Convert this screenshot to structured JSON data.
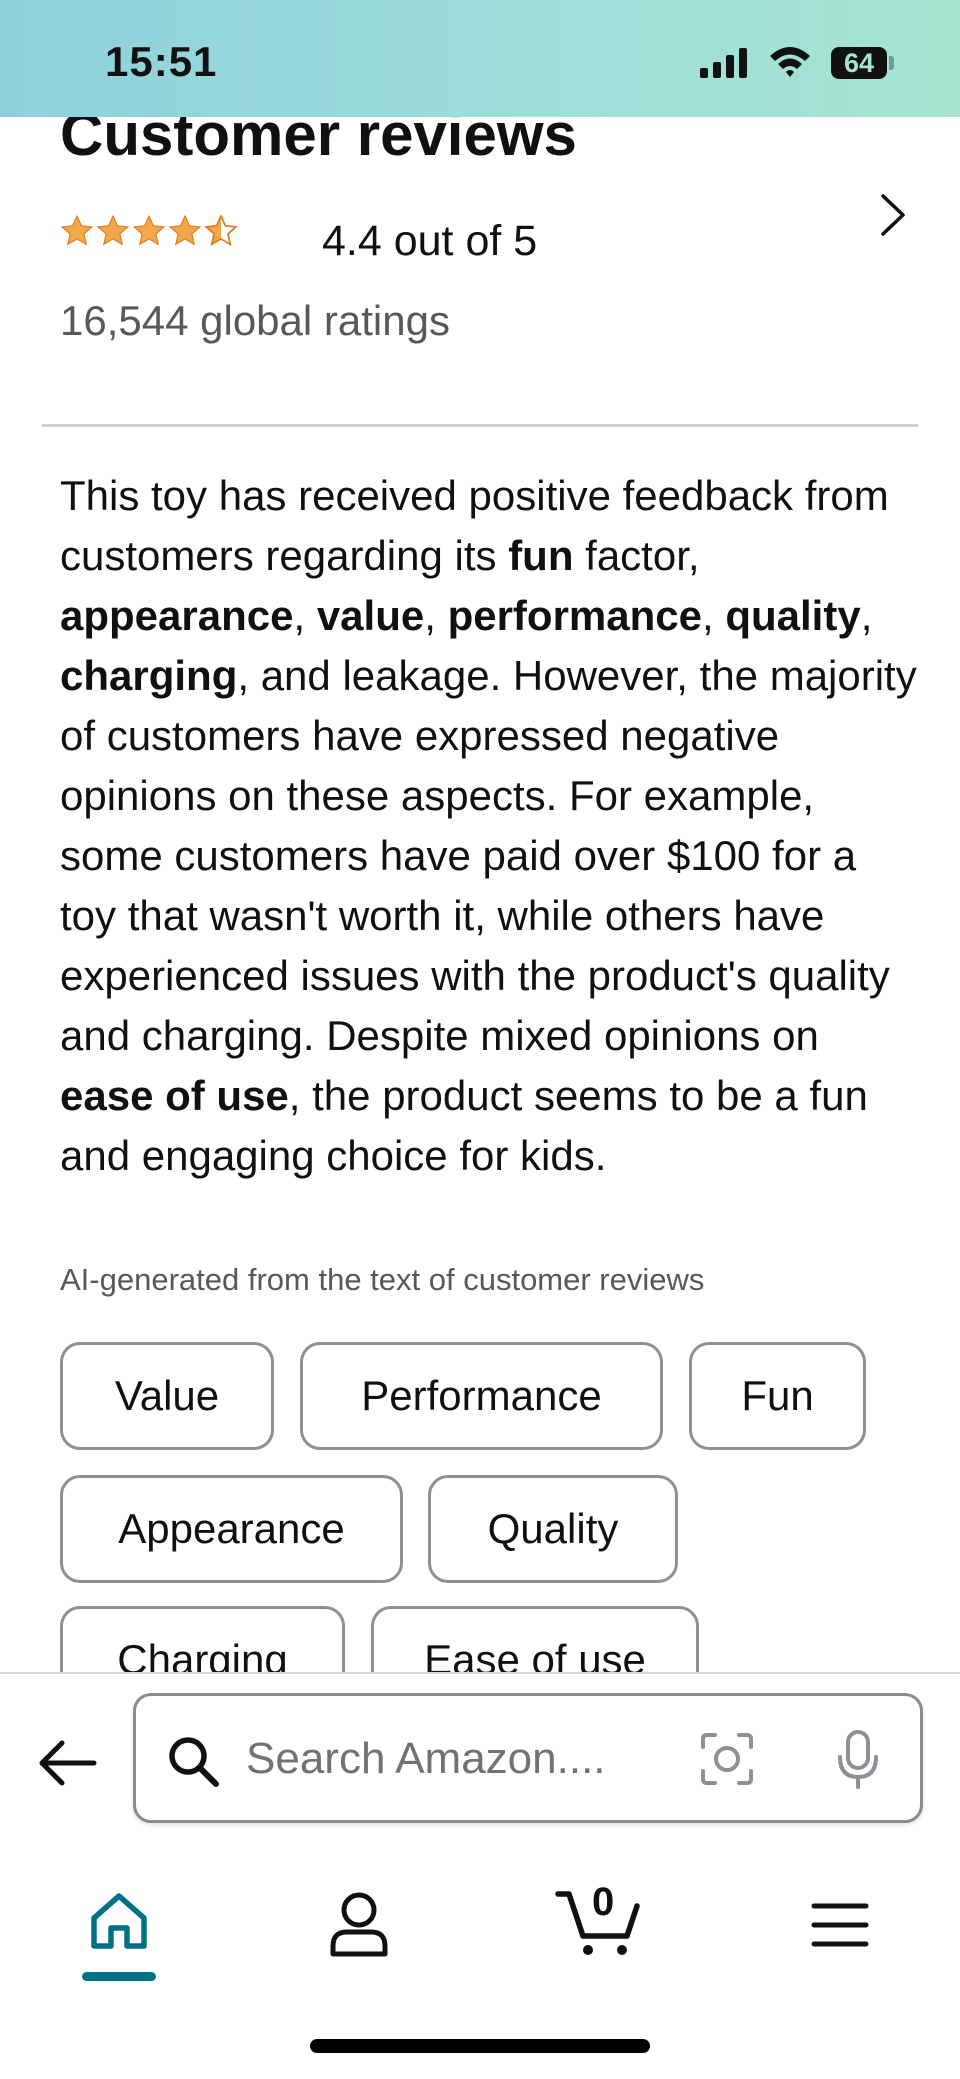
{
  "status_bar": {
    "time": "15:51",
    "battery": "64"
  },
  "reviews": {
    "title": "Customer reviews",
    "rating": 4.4,
    "rating_text": "4.4 out of 5",
    "global_ratings": "16,544 global ratings",
    "star_color": "#f3a847"
  },
  "summary": {
    "p1": "This toy has received positive feedback from customers regarding its ",
    "k1": "fun",
    "p2": " factor, ",
    "k2": "appearance",
    "p3": ", ",
    "k3": "value",
    "p4": ", ",
    "k4": "performance",
    "p5": ", ",
    "k5": "quality",
    "p6": ", ",
    "k6": "charging",
    "p7": ", and leakage. However, the majority of customers have expressed negative opinions on these aspects. For example, some customers have paid over $100 for a toy that wasn't worth it, while others have experienced issues with the product's quality and charging. Despite mixed opinions on ",
    "k7": "ease of use",
    "p8": ", the product seems to be a fun and engaging choice for kids.",
    "ai_note": "AI-generated from the text of customer reviews"
  },
  "chips": {
    "value": "Value",
    "performance": "Performance",
    "fun": "Fun",
    "appearance": "Appearance",
    "quality": "Quality",
    "charging": "Charging",
    "ease_of_use": "Ease of use"
  },
  "search": {
    "placeholder": "Search Amazon...."
  },
  "nav": {
    "cart_count": "0",
    "active_color": "#007185"
  }
}
